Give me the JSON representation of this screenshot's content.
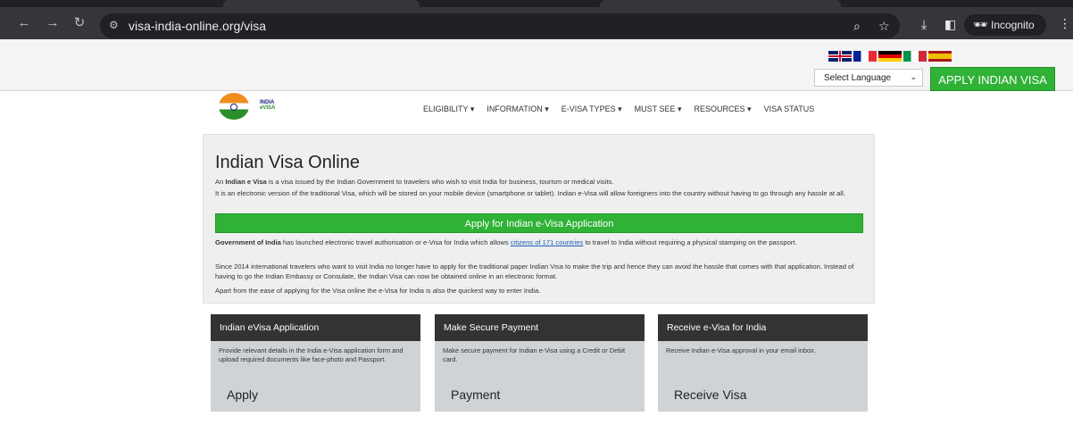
{
  "browser": {
    "url": "visa-india-online.org/visa",
    "incognito_label": "Incognito"
  },
  "topbar": {
    "flags": [
      "United Kingdom",
      "France",
      "Germany",
      "Italy",
      "Spain"
    ],
    "language_select": "Select Language",
    "apply_button": "APPLY INDIAN VISA"
  },
  "logo": {
    "line1": "INDIA",
    "line2": "eVISA"
  },
  "nav": [
    {
      "label": "ELIGIBILITY",
      "dropdown": true
    },
    {
      "label": "INFORMATION",
      "dropdown": true
    },
    {
      "label": "E-VISA TYPES",
      "dropdown": true
    },
    {
      "label": "MUST SEE",
      "dropdown": true
    },
    {
      "label": "RESOURCES",
      "dropdown": true
    },
    {
      "label": "VISA STATUS",
      "dropdown": false
    }
  ],
  "hero": {
    "title": "Indian Visa Online",
    "p1_prefix": "An ",
    "p1_bold": "Indian e Visa",
    "p1_rest": " is a visa issued by the Indian Government to travelers who wish to visit India for business, tourism or medical visits.",
    "p2": "It is an electronic version of the traditional Visa, which will be stored on your mobile device (smartphone or tablet). Indian e-Visa will allow foreigners into the country without having to go through any hassle at all.",
    "apply_button": "Apply for Indian e-Visa Application",
    "p3_bold": "Government of India",
    "p3_mid": " has launched electronic travel authorisation or e-Visa for India which allows ",
    "p3_link": "citizens of 171 countries",
    "p3_rest": " to travel to India without requiring a physical stamping on the passport.",
    "p4": "Since 2014 international travelers who want to visit India no longer have to apply for the traditional paper Indian Visa to make the trip and hence they can avoid the hassle that comes with that application. Instead of having to go the Indian Embassy or Consulate, the Indian Visa can now be obtained online in an electronic format.",
    "p5": "Apart from the ease of applying for the Visa online the e-Visa for India is also the quickest way to enter India."
  },
  "cards": [
    {
      "title": "Indian eVisa Application",
      "text": "Provide relevant details in the India e-Visa application form and upload required documents like face-photo and Passport.",
      "cta": "Apply"
    },
    {
      "title": "Make Secure Payment",
      "text": "Make secure payment for Indian e-Visa using a Credit or Debit card.",
      "cta": "Payment"
    },
    {
      "title": "Receive e-Visa for India",
      "text": "Receive Indian e-Visa approval in your email inbox.",
      "cta": "Receive Visa"
    }
  ]
}
